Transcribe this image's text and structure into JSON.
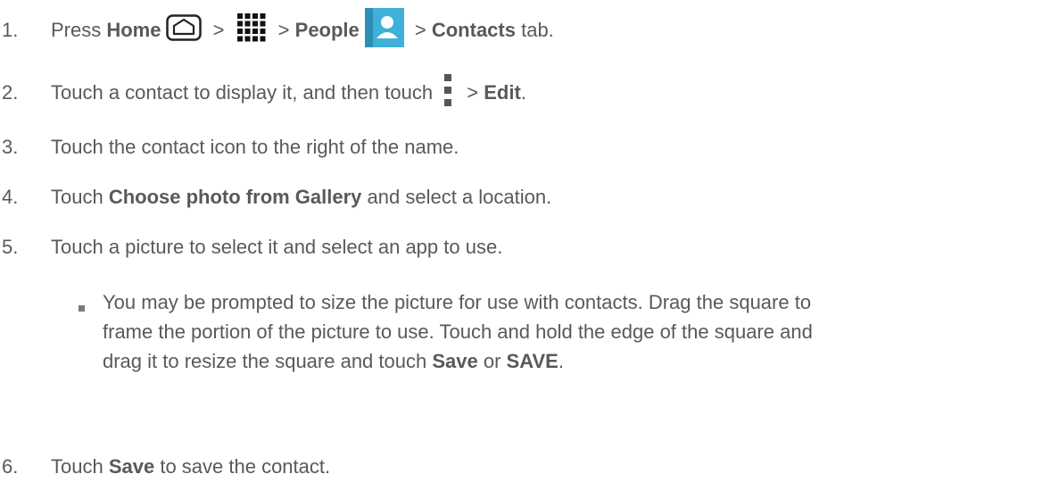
{
  "steps": [
    {
      "num": "1.",
      "p1": "Press ",
      "home": "Home",
      "sep1": " > ",
      "sep2": " > ",
      "people": "People",
      "sep3": " > ",
      "contacts": "Contacts",
      "tail": " tab."
    },
    {
      "num": "2.",
      "p1": "Touch a contact to display it, and then touch ",
      "sep1": " > ",
      "edit": "Edit",
      "tail": "."
    },
    {
      "num": "3.",
      "text": "Touch the contact icon to the right of the name."
    },
    {
      "num": "4.",
      "p1": "Touch ",
      "bold": "Choose photo from Gallery",
      "tail": " and select a location."
    },
    {
      "num": "5.",
      "text": "Touch a picture to select it and select an app to use."
    },
    {
      "num": "6.",
      "p1": "Touch ",
      "bold": "Save",
      "tail": " to save the contact."
    }
  ],
  "note": {
    "line1": "You may be prompted to size the picture for use with contacts. Drag the square to",
    "line2": "frame the portion of the picture to use. Touch and hold the edge of the square and",
    "line3_p1": "drag it to resize the square and touch ",
    "bold1": "Save",
    "mid": " or ",
    "bold2": "SAVE",
    "end": "."
  },
  "icons": {
    "home": "home-button-icon",
    "apps": "apps-grid-icon",
    "people": "people-app-icon",
    "menu": "menu-overflow-icon"
  },
  "colors": {
    "text": "#595959",
    "people_icon_bg": "#3fb0d8"
  }
}
